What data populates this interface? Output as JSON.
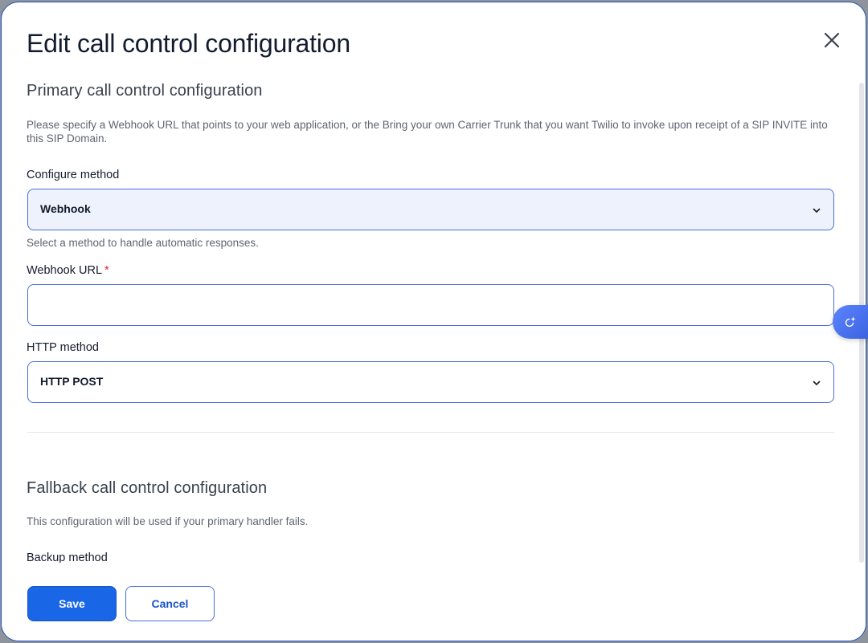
{
  "modal": {
    "title": "Edit call control configuration"
  },
  "primary": {
    "heading": "Primary call control configuration",
    "description": "Please specify a Webhook URL that points to your web application, or the Bring your own Carrier Trunk that you want Twilio to invoke upon receipt of a SIP INVITE into this SIP Domain.",
    "configure_method": {
      "label": "Configure method",
      "value": "Webhook",
      "help": "Select a method to handle automatic responses."
    },
    "webhook_url": {
      "label": "Webhook URL",
      "required_mark": "*",
      "value": ""
    },
    "http_method": {
      "label": "HTTP method",
      "value": "HTTP POST"
    }
  },
  "fallback": {
    "heading": "Fallback call control configuration",
    "description": "This configuration will be used if your primary handler fails.",
    "backup_method_label": "Backup method"
  },
  "footer": {
    "save_label": "Save",
    "cancel_label": "Cancel"
  },
  "icons": {
    "close": "close-icon",
    "chevron": "chevron-down-icon",
    "assistant": "ai-sparkle-icon"
  },
  "colors": {
    "primary": "#1966e6",
    "border_focus": "#4a6fd6",
    "required": "#d6272e",
    "heading": "#121c2d"
  }
}
